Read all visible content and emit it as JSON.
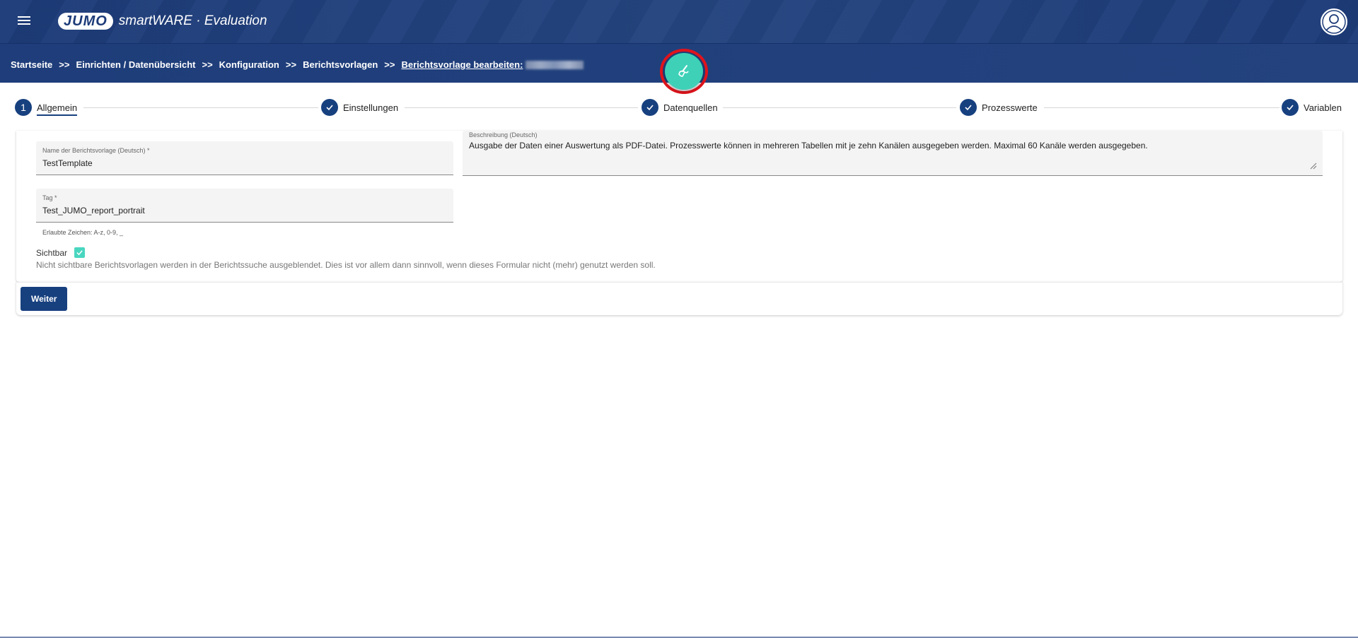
{
  "header": {
    "logo_brand": "JUMO",
    "logo_product": "smartWARE · Evaluation",
    "menu_icon": "hamburger-menu-icon",
    "avatar_icon": "user-avatar-icon"
  },
  "breadcrumb": {
    "items": [
      "Startseite",
      "Einrichten / Datenübersicht",
      "Konfiguration",
      "Berichtsvorlagen"
    ],
    "separator": ">>",
    "current": "Berichtsvorlage bearbeiten:"
  },
  "fab": {
    "icon": "broom-clean-icon",
    "color": "#3ed1b8",
    "highlight_color": "#e0141c"
  },
  "stepper": {
    "steps": [
      {
        "number": "1",
        "label": "Allgemein",
        "state": "active"
      },
      {
        "label": "Einstellungen",
        "state": "done"
      },
      {
        "label": "Datenquellen",
        "state": "done"
      },
      {
        "label": "Prozesswerte",
        "state": "done"
      },
      {
        "label": "Variablen",
        "state": "done"
      }
    ]
  },
  "form": {
    "name": {
      "label": "Name der Berichtsvorlage (Deutsch) *",
      "value": "TestTemplate"
    },
    "description": {
      "label": "Beschreibung (Deutsch)",
      "value": "Ausgabe der Daten einer Auswertung als PDF-Datei. Prozesswerte können in mehreren Tabellen mit je zehn Kanälen ausgegeben werden. Maximal 60 Kanäle werden ausgegeben."
    },
    "tag": {
      "label": "Tag *",
      "value": "Test_JUMO_report_portrait",
      "hint": "Erlaubte Zeichen: A-z, 0-9, _"
    },
    "visible": {
      "label": "Sichtbar",
      "checked": true,
      "help": "Nicht sichtbare Berichtsvorlagen werden in der Berichtssuche ausgeblendet. Dies ist vor allem dann sinnvoll, wenn dieses Formular nicht (mehr) genutzt werden soll."
    }
  },
  "actions": {
    "next_label": "Weiter"
  },
  "colors": {
    "primary": "#17407f",
    "header": "#1d3b78",
    "accent": "#3ed1b8"
  }
}
